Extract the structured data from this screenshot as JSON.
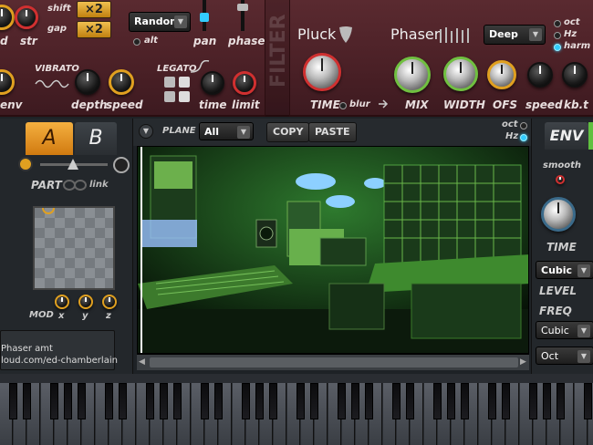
{
  "top": {
    "shift_label": "shift",
    "gap_label": "gap",
    "shift_value": "×2",
    "gap_value": "×2",
    "str_label": "str",
    "d_label": "d",
    "random_select": "Random",
    "alt_label": "alt",
    "pan_label": "pan",
    "phase_label": "phase",
    "filter_watermark": "FILTER",
    "vibrato_label": "VIBRATO",
    "depth_label": "depth",
    "speed_label": "speed",
    "env_label": "env",
    "legato_label": "LEGATO",
    "time_label": "time",
    "limit_label": "limit",
    "pluck_label": "Pluck",
    "pluck_time_label": "TIME",
    "blur_label": "blur",
    "phaser_label": "Phaser",
    "phaser_mode": "Deep",
    "oct_label": "oct",
    "hz_label": "Hz",
    "harm_label": "harm",
    "mix_label": "MIX",
    "width_label": "WIDTH",
    "ofs_label": "OFS",
    "phaser_speed_label": "speed",
    "kbt_label": "kb.t"
  },
  "left": {
    "tab_a": "A",
    "tab_b": "B",
    "part_label": "PART",
    "link_label": "link",
    "mod_label": "MOD",
    "x_label": "x",
    "y_label": "y",
    "z_label": "z",
    "info_line1": "Phaser amt",
    "info_line2": "loud.com/ed-chamberlain"
  },
  "center": {
    "plane_label": "PLANE",
    "plane_select": "All",
    "copy_button": "COPY",
    "paste_button": "PASTE",
    "oct_label": "oct",
    "hz_label": "Hz"
  },
  "right": {
    "env_tab": "ENV",
    "smooth_label": "smooth",
    "time_label": "TIME",
    "cubic_select1": "Cubic",
    "level_label": "LEVEL",
    "freq_label": "FREQ",
    "cubic_select2": "Cubic",
    "oct_select": "Oct"
  }
}
